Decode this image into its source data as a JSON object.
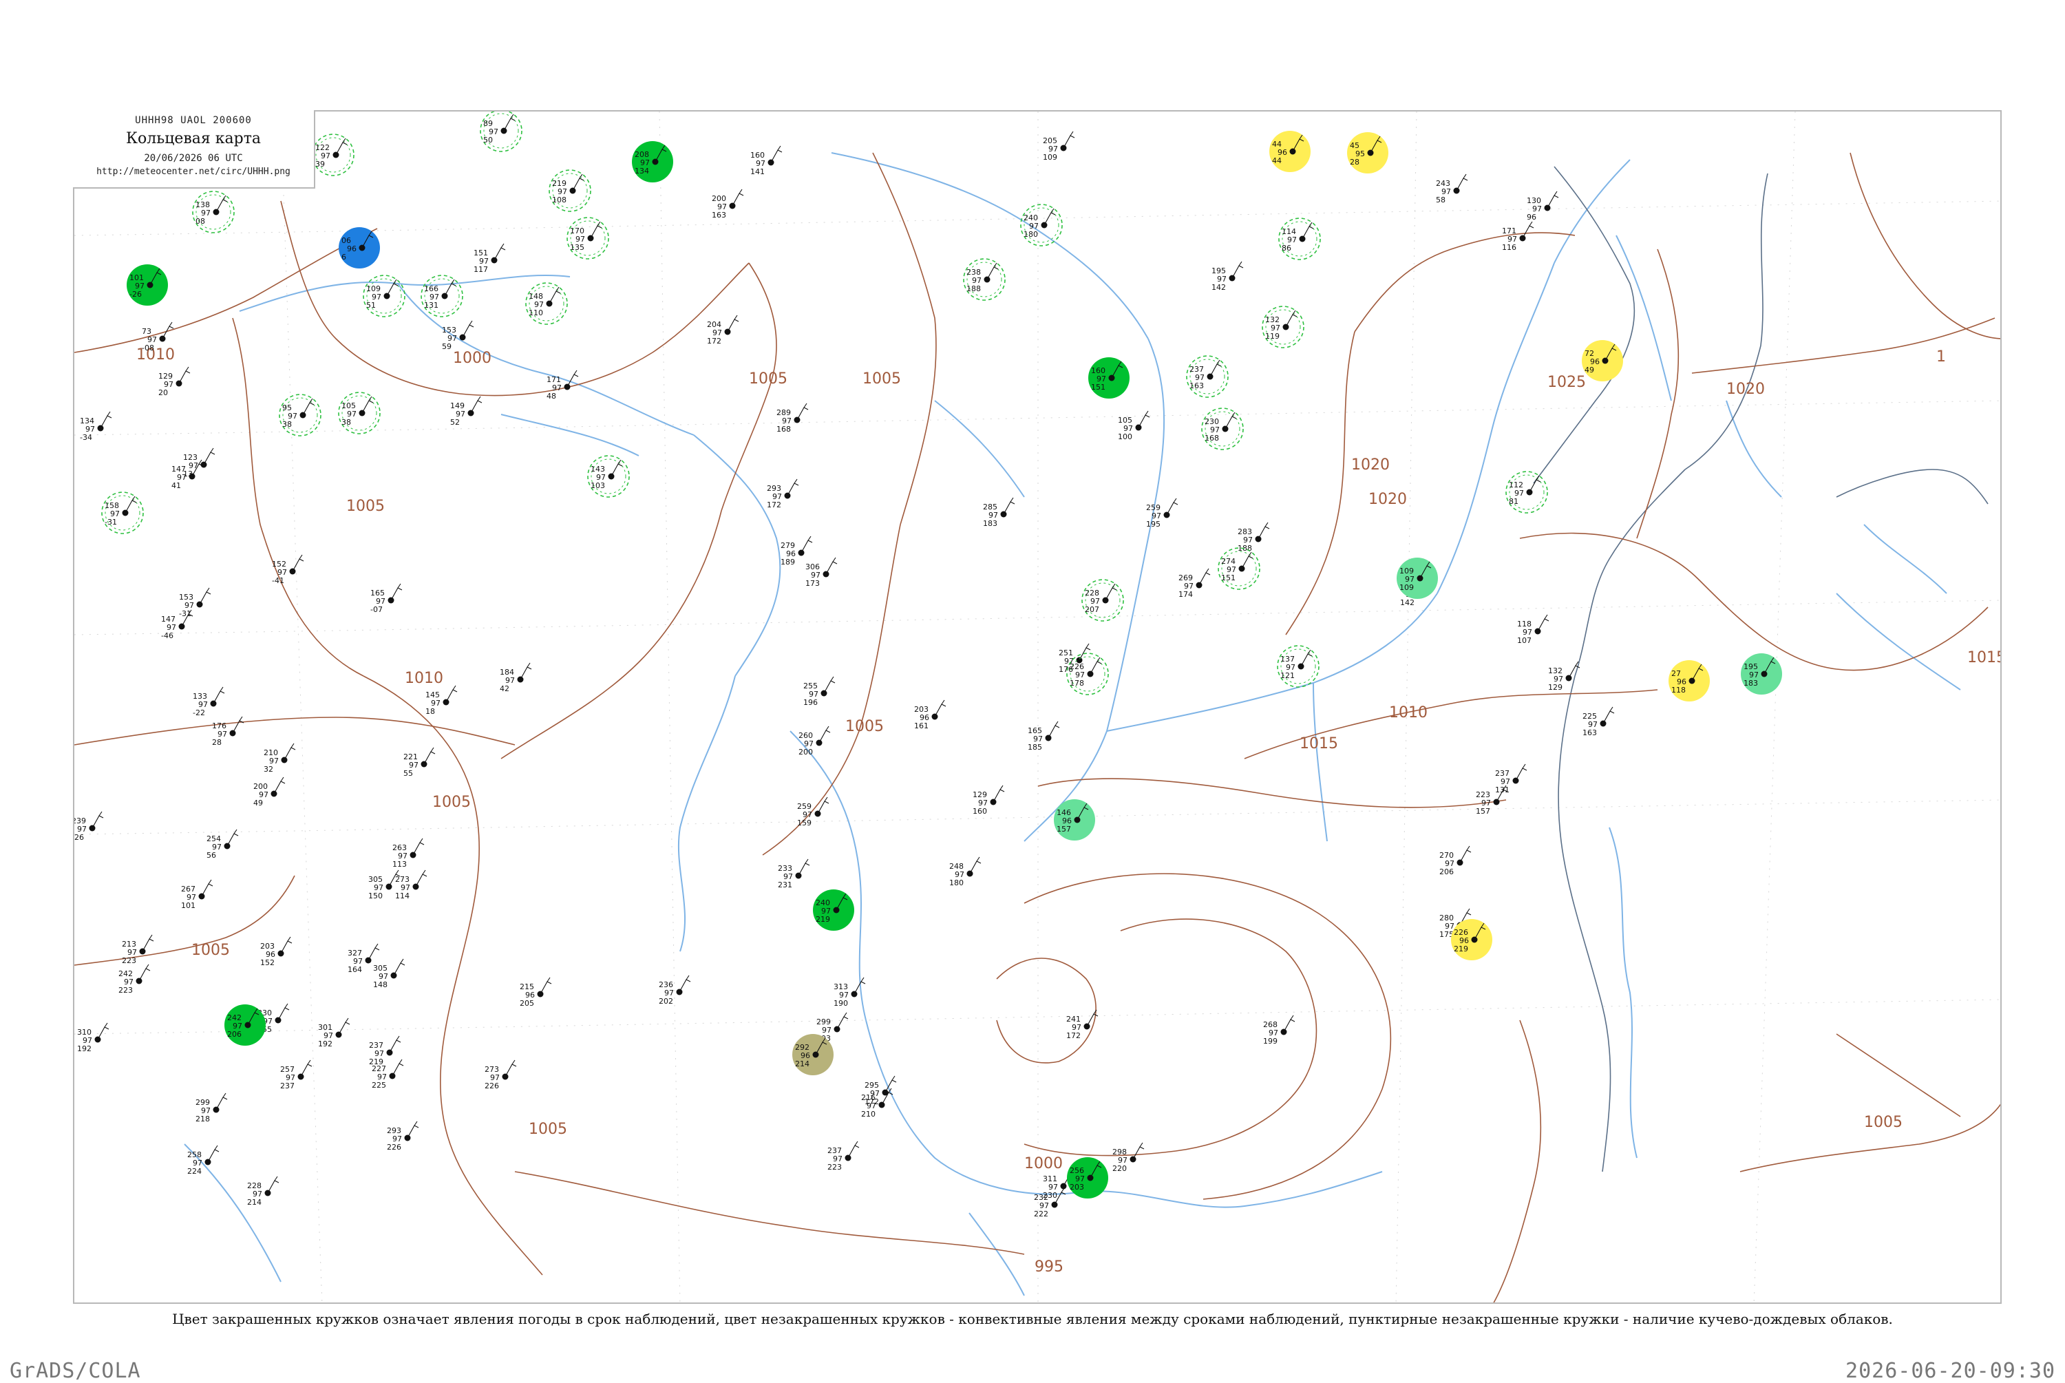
{
  "header": {
    "code": "UHHH98  UAOL  200600",
    "title": "Кольцевая карта",
    "date": "20/06/2026 06 UTC",
    "url": "http://meteocenter.net/circ/UHHH.png"
  },
  "caption": "Цвет закрашенных кружков означает явления погоды в срок наблюдений, цвет незакрашенных кружков - конвективные явления между сроками наблюдений, пунктирные незакрашенные кружки - наличие кучево-дождевых облаков.",
  "footer": {
    "left": "GrADS/COLA",
    "right": "2026-06-20-09:30"
  },
  "colors": {
    "isobar": "#a05a3c",
    "river": "#7fb4e6",
    "rain_fill": "#00c030",
    "shower_light": "#66e09a",
    "blue": "#1e7fe0",
    "yellow": "#ffee55",
    "olive": "#b7b27a",
    "cb_dash": "#2ec040",
    "frame": "#b8b8b8"
  },
  "isobars": [
    {
      "label": "1010"
    },
    {
      "label": "1000"
    },
    {
      "label": "1005"
    },
    {
      "label": "1005"
    },
    {
      "label": "1005"
    },
    {
      "label": "1010"
    },
    {
      "label": "1005"
    },
    {
      "label": "1005"
    },
    {
      "label": "1005"
    },
    {
      "label": "1000"
    },
    {
      "label": "995"
    },
    {
      "label": "1005"
    },
    {
      "label": "1010"
    },
    {
      "label": "1015"
    },
    {
      "label": "1020"
    },
    {
      "label": "1020"
    },
    {
      "label": "1025"
    },
    {
      "label": "1020"
    },
    {
      "label": "1015"
    },
    {
      "label": "1005"
    },
    {
      "label": "1"
    }
  ],
  "stations": [
    {
      "t": "101",
      "p": "97",
      "d": "-26",
      "kind": "rain"
    },
    {
      "t": "138",
      "p": "97",
      "d": "08",
      "kind": "cb"
    },
    {
      "t": "06",
      "p": "96",
      "d": "6",
      "kind": "blue"
    },
    {
      "t": "122",
      "p": "97",
      "d": "39",
      "kind": "cb"
    },
    {
      "t": "89",
      "p": "97",
      "d": "50",
      "kind": "cb"
    },
    {
      "t": "219",
      "p": "97",
      "d": "108",
      "kind": "cb"
    },
    {
      "t": "208",
      "p": "97",
      "d": "134",
      "kind": "rain"
    },
    {
      "t": "170",
      "p": "97",
      "d": "135",
      "kind": "cb"
    },
    {
      "t": "200",
      "p": "97",
      "d": "163",
      "kind": "plain"
    },
    {
      "t": "160",
      "p": "97",
      "d": "141",
      "kind": "plain"
    },
    {
      "t": "205",
      "p": "97",
      "d": "109",
      "kind": "plain"
    },
    {
      "t": "44",
      "p": "96",
      "d": "44",
      "kind": "yellow"
    },
    {
      "t": "45",
      "p": "95",
      "d": "28",
      "kind": "yellow"
    },
    {
      "t": "243",
      "p": "97",
      "d": "58",
      "kind": "plain"
    },
    {
      "t": "130",
      "p": "97",
      "d": "96",
      "kind": "plain"
    },
    {
      "t": "73",
      "p": "97",
      "d": "-08",
      "kind": "plain"
    },
    {
      "t": "148",
      "p": "97",
      "d": "110",
      "kind": "cb"
    },
    {
      "t": "166",
      "p": "97",
      "d": "131",
      "kind": "cb"
    },
    {
      "t": "151",
      "p": "97",
      "d": "117",
      "kind": "plain"
    },
    {
      "t": "109",
      "p": "97",
      "d": "51",
      "kind": "cb"
    },
    {
      "t": "153",
      "p": "97",
      "d": "59",
      "kind": "plain"
    },
    {
      "t": "204",
      "p": "97",
      "d": "172",
      "kind": "plain"
    },
    {
      "t": "240",
      "p": "97",
      "d": "180",
      "kind": "cb"
    },
    {
      "t": "238",
      "p": "97",
      "d": "188",
      "kind": "cb"
    },
    {
      "t": "195",
      "p": "97",
      "d": "142",
      "kind": "plain"
    },
    {
      "t": "132",
      "p": "97",
      "d": "119",
      "kind": "cb"
    },
    {
      "t": "114",
      "p": "97",
      "d": "86",
      "kind": "cb"
    },
    {
      "t": "171",
      "p": "97",
      "d": "116",
      "kind": "plain"
    },
    {
      "t": "72",
      "p": "96",
      "d": "49",
      "kind": "yellow"
    },
    {
      "t": "134",
      "p": "97",
      "d": "-34",
      "kind": "plain"
    },
    {
      "t": "129",
      "p": "97",
      "d": "20",
      "kind": "plain"
    },
    {
      "t": "95",
      "p": "97",
      "d": "38",
      "kind": "cb"
    },
    {
      "t": "105",
      "p": "97",
      "d": "38",
      "kind": "cb"
    },
    {
      "t": "149",
      "p": "97",
      "d": "52",
      "kind": "plain"
    },
    {
      "t": "171",
      "p": "97",
      "d": "48",
      "kind": "plain"
    },
    {
      "t": "289",
      "p": "97",
      "d": "168",
      "kind": "plain"
    },
    {
      "t": "160",
      "p": "97",
      "d": "151",
      "kind": "rain"
    },
    {
      "t": "237",
      "p": "97",
      "d": "163",
      "kind": "cb"
    },
    {
      "t": "230",
      "p": "97",
      "d": "168",
      "kind": "cb"
    },
    {
      "t": "105",
      "p": "97",
      "d": "100",
      "kind": "plain"
    },
    {
      "t": "158",
      "p": "97",
      "d": "-31",
      "kind": "cb"
    },
    {
      "t": "123",
      "p": "97",
      "d": "13",
      "kind": "plain"
    },
    {
      "t": "147",
      "p": "97",
      "d": "41",
      "kind": "plain"
    },
    {
      "t": "143",
      "p": "97",
      "d": "103",
      "kind": "cb"
    },
    {
      "t": "293",
      "p": "97",
      "d": "172",
      "kind": "plain"
    },
    {
      "t": "285",
      "p": "97",
      "d": "183",
      "kind": "plain"
    },
    {
      "t": "259",
      "p": "97",
      "d": "195",
      "kind": "plain"
    },
    {
      "t": "228",
      "p": "97",
      "d": "207",
      "kind": "cb"
    },
    {
      "t": "283",
      "p": "97",
      "d": "188",
      "kind": "plain"
    },
    {
      "t": "179",
      "p": "97",
      "d": "142",
      "kind": "plain"
    },
    {
      "t": "109",
      "p": "97",
      "d": "109",
      "kind": "shower"
    },
    {
      "t": "112",
      "p": "97",
      "d": "81",
      "kind": "cb"
    },
    {
      "t": "152",
      "p": "97",
      "d": "-41",
      "kind": "plain"
    },
    {
      "t": "153",
      "p": "97",
      "d": "-31",
      "kind": "plain"
    },
    {
      "t": "279",
      "p": "96",
      "d": "189",
      "kind": "plain"
    },
    {
      "t": "306",
      "p": "97",
      "d": "173",
      "kind": "plain"
    },
    {
      "t": "269",
      "p": "97",
      "d": "174",
      "kind": "plain"
    },
    {
      "t": "274",
      "p": "97",
      "d": "151",
      "kind": "cb"
    },
    {
      "t": "118",
      "p": "97",
      "d": "107",
      "kind": "plain"
    },
    {
      "t": "147",
      "p": "97",
      "d": "-46",
      "kind": "plain"
    },
    {
      "t": "165",
      "p": "97",
      "d": "-07",
      "kind": "plain"
    },
    {
      "t": "184",
      "p": "97",
      "d": "42",
      "kind": "plain"
    },
    {
      "t": "255",
      "p": "97",
      "d": "196",
      "kind": "plain"
    },
    {
      "t": "251",
      "p": "97",
      "d": "176",
      "kind": "plain"
    },
    {
      "t": "226",
      "p": "97",
      "d": "178",
      "kind": "cb"
    },
    {
      "t": "137",
      "p": "97",
      "d": "121",
      "kind": "cb"
    },
    {
      "t": "132",
      "p": "97",
      "d": "129",
      "kind": "plain"
    },
    {
      "t": "27",
      "p": "96",
      "d": "118",
      "kind": "yellow"
    },
    {
      "t": "195",
      "p": "97",
      "d": "183",
      "kind": "shower"
    },
    {
      "t": "133",
      "p": "97",
      "d": "-22",
      "kind": "plain"
    },
    {
      "t": "145",
      "p": "97",
      "d": "18",
      "kind": "plain"
    },
    {
      "t": "260",
      "p": "97",
      "d": "200",
      "kind": "plain"
    },
    {
      "t": "203",
      "p": "96",
      "d": "161",
      "kind": "plain"
    },
    {
      "t": "165",
      "p": "97",
      "d": "185",
      "kind": "plain"
    },
    {
      "t": "237",
      "p": "97",
      "d": "131",
      "kind": "plain"
    },
    {
      "t": "225",
      "p": "97",
      "d": "163",
      "kind": "plain"
    },
    {
      "t": "176",
      "p": "97",
      "d": "28",
      "kind": "plain"
    },
    {
      "t": "210",
      "p": "97",
      "d": "32",
      "kind": "plain"
    },
    {
      "t": "221",
      "p": "97",
      "d": "55",
      "kind": "plain"
    },
    {
      "t": "259",
      "p": "97",
      "d": "159",
      "kind": "plain"
    },
    {
      "t": "129",
      "p": "97",
      "d": "160",
      "kind": "plain"
    },
    {
      "t": "146",
      "p": "96",
      "d": "157",
      "kind": "shower"
    },
    {
      "t": "223",
      "p": "97",
      "d": "157",
      "kind": "plain"
    },
    {
      "t": "200",
      "p": "97",
      "d": "49",
      "kind": "plain"
    },
    {
      "t": "248",
      "p": "97",
      "d": "180",
      "kind": "plain"
    },
    {
      "t": "233",
      "p": "97",
      "d": "231",
      "kind": "plain"
    },
    {
      "t": "270",
      "p": "97",
      "d": "206",
      "kind": "plain"
    },
    {
      "t": "239",
      "p": "97",
      "d": "-26",
      "kind": "plain"
    },
    {
      "t": "254",
      "p": "97",
      "d": "56",
      "kind": "plain"
    },
    {
      "t": "263",
      "p": "97",
      "d": "113",
      "kind": "plain"
    },
    {
      "t": "280",
      "p": "97",
      "d": "175",
      "kind": "plain"
    },
    {
      "t": "267",
      "p": "97",
      "d": "101",
      "kind": "plain"
    },
    {
      "t": "305",
      "p": "97",
      "d": "150",
      "kind": "plain"
    },
    {
      "t": "273",
      "p": "97",
      "d": "114",
      "kind": "plain"
    },
    {
      "t": "240",
      "p": "97",
      "d": "219",
      "kind": "rain"
    },
    {
      "t": "226",
      "p": "96",
      "d": "219",
      "kind": "yellow"
    },
    {
      "t": "213",
      "p": "97",
      "d": "223",
      "kind": "plain"
    },
    {
      "t": "203",
      "p": "96",
      "d": "152",
      "kind": "plain"
    },
    {
      "t": "327",
      "p": "97",
      "d": "164",
      "kind": "plain"
    },
    {
      "t": "313",
      "p": "97",
      "d": "190",
      "kind": "plain"
    },
    {
      "t": "241",
      "p": "97",
      "d": "172",
      "kind": "plain"
    },
    {
      "t": "216",
      "p": "97",
      "d": "210",
      "kind": "plain"
    },
    {
      "t": "242",
      "p": "97",
      "d": "223",
      "kind": "plain"
    },
    {
      "t": "330",
      "p": "97",
      "d": "155",
      "kind": "plain"
    },
    {
      "t": "305",
      "p": "97",
      "d": "148",
      "kind": "plain"
    },
    {
      "t": "215",
      "p": "96",
      "d": "205",
      "kind": "plain"
    },
    {
      "t": "236",
      "p": "97",
      "d": "202",
      "kind": "plain"
    },
    {
      "t": "299",
      "p": "97",
      "d": "203",
      "kind": "plain"
    },
    {
      "t": "295",
      "p": "97",
      "d": "172",
      "kind": "plain"
    },
    {
      "t": "310",
      "p": "97",
      "d": "192",
      "kind": "plain"
    },
    {
      "t": "242",
      "p": "97",
      "d": "206",
      "kind": "rain"
    },
    {
      "t": "292",
      "p": "96",
      "d": "214",
      "kind": "olive"
    },
    {
      "t": "268",
      "p": "97",
      "d": "199",
      "kind": "plain"
    },
    {
      "t": "301",
      "p": "97",
      "d": "192",
      "kind": "plain"
    },
    {
      "t": "237",
      "p": "97",
      "d": "219",
      "kind": "plain"
    },
    {
      "t": "273",
      "p": "97",
      "d": "226",
      "kind": "plain"
    },
    {
      "t": "227",
      "p": "97",
      "d": "225",
      "kind": "plain"
    },
    {
      "t": "299",
      "p": "97",
      "d": "218",
      "kind": "plain"
    },
    {
      "t": "298",
      "p": "97",
      "d": "220",
      "kind": "plain"
    },
    {
      "t": "258",
      "p": "97",
      "d": "224",
      "kind": "plain"
    },
    {
      "t": "257",
      "p": "97",
      "d": "237",
      "kind": "plain"
    },
    {
      "t": "293",
      "p": "97",
      "d": "226",
      "kind": "plain"
    },
    {
      "t": "237",
      "p": "97",
      "d": "223",
      "kind": "plain"
    },
    {
      "t": "311",
      "p": "97",
      "d": "230",
      "kind": "plain"
    },
    {
      "t": "256",
      "p": "97",
      "d": "203",
      "kind": "rain"
    },
    {
      "t": "232",
      "p": "97",
      "d": "222",
      "kind": "plain"
    },
    {
      "t": "228",
      "p": "97",
      "d": "214",
      "kind": "plain"
    }
  ]
}
